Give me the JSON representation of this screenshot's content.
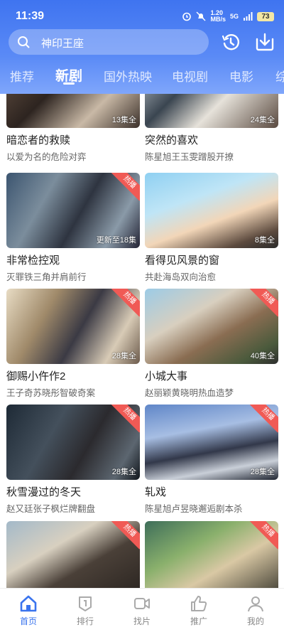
{
  "status_bar": {
    "time": "11:39",
    "net_speed": "1.20",
    "net_unit": "MB/s",
    "signal": "5G",
    "battery": "73"
  },
  "search": {
    "placeholder": "神印王座"
  },
  "tabs": [
    {
      "label": "推荐"
    },
    {
      "label": "新剧",
      "active": true
    },
    {
      "label": "国外热映"
    },
    {
      "label": "电视剧"
    },
    {
      "label": "电影"
    },
    {
      "label": "综"
    }
  ],
  "hot_badge": "热播",
  "cards": [
    {
      "title": "暗恋者的救赎",
      "subtitle": "以爱为名的危险对弈",
      "episodes": "13集全",
      "hot": false
    },
    {
      "title": "突然的喜欢",
      "subtitle": "陈星旭王玉雯蹭股开撩",
      "episodes": "24集全",
      "hot": false
    },
    {
      "title": "非常检控观",
      "subtitle": "灭罪铁三角并肩前行",
      "episodes": "更新至18集",
      "hot": true
    },
    {
      "title": "看得见风景的窗",
      "subtitle": "共赴海岛双向治愈",
      "episodes": "8集全",
      "hot": false
    },
    {
      "title": "御赐小仵作2",
      "subtitle": "王子奇苏晓彤智破奇案",
      "episodes": "28集全",
      "hot": true
    },
    {
      "title": "小城大事",
      "subtitle": "赵丽颖黄晓明热血造梦",
      "episodes": "40集全",
      "hot": true
    },
    {
      "title": "秋雪漫过的冬天",
      "subtitle": "赵又廷张子枫烂牌翻盘",
      "episodes": "28集全",
      "hot": true
    },
    {
      "title": "轧戏",
      "subtitle": "陈星旭卢昱晓邂逅剧本杀",
      "episodes": "28集全",
      "hot": true
    },
    {
      "title": "",
      "subtitle": "",
      "episodes": "",
      "hot": true
    },
    {
      "title": "",
      "subtitle": "",
      "episodes": "",
      "hot": true
    }
  ],
  "bottom_nav": [
    {
      "label": "首页",
      "active": true
    },
    {
      "label": "排行"
    },
    {
      "label": "找片"
    },
    {
      "label": "推广"
    },
    {
      "label": "我的"
    }
  ],
  "colors": {
    "accent": "#3a74ee",
    "hot_badge": "#f05a55"
  }
}
